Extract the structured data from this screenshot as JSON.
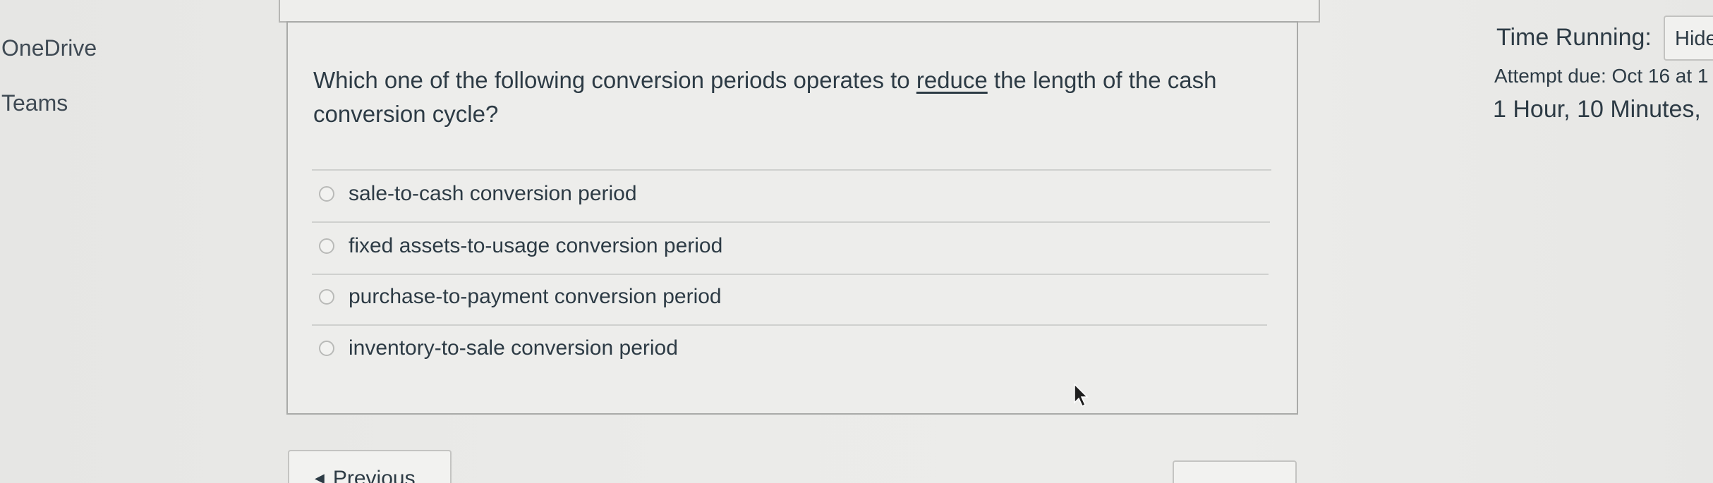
{
  "nav": {
    "onedrive": "OneDrive",
    "teams": "Teams"
  },
  "question": {
    "text_before": "Which one of the following conversion periods operates to ",
    "text_emphasis": "reduce",
    "text_after": " the length of the cash conversion cycle?",
    "answers": [
      {
        "label": "sale-to-cash conversion period"
      },
      {
        "label": "fixed assets-to-usage conversion period"
      },
      {
        "label": "purchase-to-payment conversion period"
      },
      {
        "label": "inventory-to-sale conversion period"
      }
    ]
  },
  "footer": {
    "previous_label": "Previous",
    "previous_icon": "triangle-left-icon"
  },
  "sidebar": {
    "time_running_label": "Time Running:",
    "hide_label": "Hide",
    "attempt_due": "Attempt due: Oct 16 at 1",
    "time_remaining": "1 Hour, 10 Minutes, "
  },
  "colors": {
    "background": "#e9e9e7",
    "text": "#2d3b45",
    "border": "#a9aaa8"
  }
}
